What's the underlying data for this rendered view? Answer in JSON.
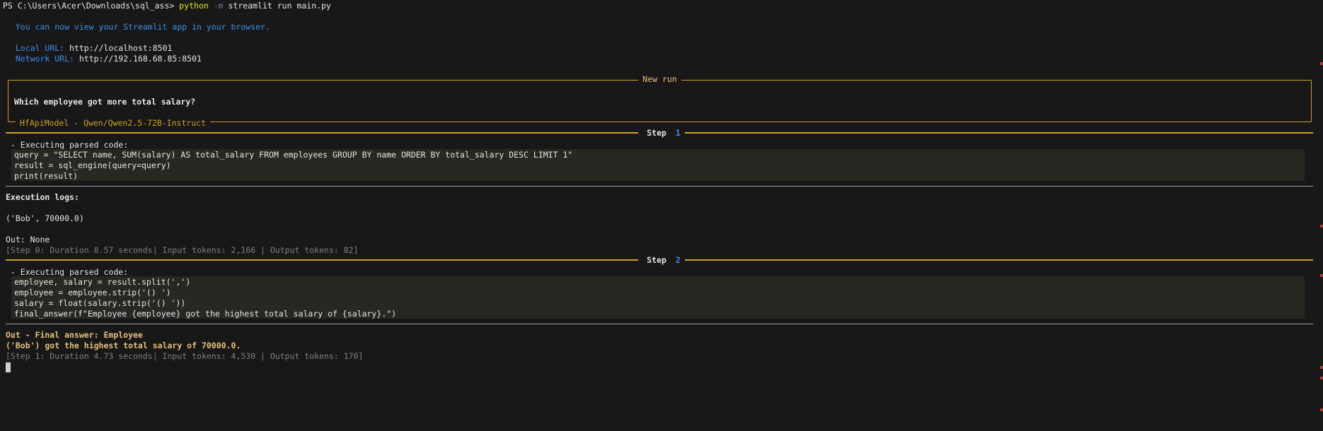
{
  "prompt_line": {
    "prefix": "PS C:\\Users\\Acer\\Downloads\\sql_ass> ",
    "command": "python",
    "flag": " -m ",
    "args": "streamlit run main.py"
  },
  "streamlit": {
    "view_msg": "  You can now view your Streamlit app in your browser.",
    "local_label": "  Local URL: ",
    "local_url": "http://localhost:8501",
    "network_label": "  Network URL: ",
    "network_url": "http://192.168.68.85:8501"
  },
  "panel": {
    "title": "New run",
    "question": "Which employee got more total salary?",
    "model": "HfApiModel - Qwen/Qwen2.5-72B-Instruct"
  },
  "step1": {
    "label": "Step ",
    "num": "1",
    "exec_label": " - Executing parsed code: ",
    "code": [
      "query = \"SELECT name, SUM(salary) AS total_salary FROM employees GROUP BY name ORDER BY total_salary DESC LIMIT 1\"",
      "result = sql_engine(query=query)",
      "print(result)"
    ],
    "logs_label": "Execution logs:",
    "log_output": "('Bob', 70000.0)",
    "out": "Out: None",
    "stats": "[Step 0: Duration 8.57 seconds| Input tokens: 2,166 | Output tokens: 82]"
  },
  "step2": {
    "label": "Step ",
    "num": "2",
    "exec_label": " - Executing parsed code: ",
    "code": [
      "employee, salary = result.split(',')",
      "employee = employee.strip('() ')",
      "salary = float(salary.strip('() '))",
      "final_answer(f\"Employee {employee} got the highest total salary of {salary}.\")"
    ],
    "final_answer_1": "Out - Final answer: Employee",
    "final_answer_2": "('Bob') got the highest total salary of 70000.0.",
    "stats": "[Step 1: Duration 4.73 seconds| Input tokens: 4,530 | Output tokens: 170]"
  },
  "colors": {
    "background": "#181818",
    "accent_gold": "#c9a227",
    "link_blue": "#3b8eea"
  }
}
